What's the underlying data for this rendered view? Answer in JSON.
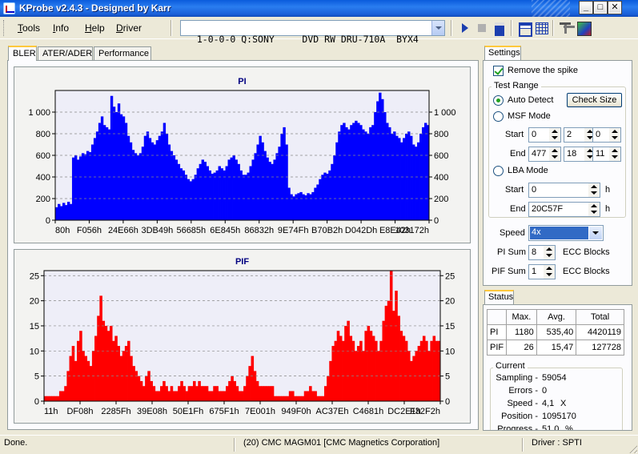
{
  "window": {
    "title": "KProbe v2.4.3 - Designed by Karr",
    "minimize": "_",
    "maximize": "□",
    "close": "✕"
  },
  "menu": {
    "items": [
      {
        "label": "Tools",
        "accel": "T"
      },
      {
        "label": "Info",
        "accel": "I"
      },
      {
        "label": "Help",
        "accel": "H"
      },
      {
        "label": "Driver",
        "accel": "D"
      }
    ]
  },
  "toolbar": {
    "drive": "1-0-0-0 Q:SONY     DVD RW DRU-710A  BYX4"
  },
  "tabs": [
    "BLER",
    "ATER/ADER",
    "Performance"
  ],
  "settings": {
    "tab": "Settings",
    "remove_spike": "Remove the spike",
    "test_range": "Test Range",
    "auto_detect": "Auto Detect",
    "check_size": "Check Size",
    "msf_mode": "MSF Mode",
    "start_label": "Start",
    "end_label": "End",
    "msf_start": [
      "0",
      "2",
      "0"
    ],
    "msf_end": [
      "477",
      "18",
      "11"
    ],
    "lba_mode": "LBA Mode",
    "lba_start": "0",
    "lba_end": "20C57F",
    "h_unit": "h",
    "speed_label": "Speed",
    "speed_value": "4x",
    "pi_sum_label": "PI Sum",
    "pi_sum_value": "8",
    "pif_sum_label": "PIF Sum",
    "pif_sum_value": "1",
    "ecc_blocks": "ECC Blocks"
  },
  "status": {
    "tab": "Status",
    "headers": [
      "",
      "Max.",
      "Avg.",
      "Total"
    ],
    "rows": [
      [
        "PI",
        "1180",
        "535,40",
        "4420119"
      ],
      [
        "PIF",
        "26",
        "15,47",
        "127728"
      ]
    ],
    "current": "Current",
    "sampling_label": "Sampling -",
    "sampling_value": "59054",
    "errors_label": "Errors -",
    "errors_value": "0",
    "speed_label": "Speed -",
    "speed_value": "4,1",
    "speed_unit": "X",
    "position_label": "Position -",
    "position_value": "1095170",
    "progress_label": "Progress -",
    "progress_value": "51,0",
    "progress_unit": "%"
  },
  "statusbar": {
    "left": "Done.",
    "media": "(20) CMC MAGM01 [CMC Magnetics Corporation]",
    "driver": "Driver : SPTI"
  },
  "colors": {
    "pi": "#0000ff",
    "pif": "#ff0000",
    "plot_bg": "#eeeef8"
  },
  "chart_data": [
    {
      "type": "area",
      "title": "PI",
      "ylim": [
        0,
        1200
      ],
      "y_ticks": [
        0,
        200,
        400,
        600,
        800,
        1000
      ],
      "y_tick_labels": [
        "0",
        "200",
        "400",
        "600",
        "800",
        "1 000"
      ],
      "x_tick_labels": [
        "80h",
        "F056h",
        "24E66h",
        "3DB49h",
        "56685h",
        "6E845h",
        "86832h",
        "9E74Fh",
        "B70B2h",
        "D042Dh",
        "E8E42h",
        "103172h"
      ],
      "x_range": [
        0,
        1095170
      ],
      "grid": true,
      "values": [
        120,
        150,
        130,
        160,
        140,
        170,
        150,
        580,
        600,
        560,
        590,
        620,
        610,
        640,
        630,
        700,
        760,
        820,
        900,
        960,
        880,
        860,
        840,
        1150,
        1050,
        1000,
        1080,
        980,
        960,
        900,
        780,
        720,
        650,
        620,
        600,
        620,
        680,
        780,
        820,
        760,
        720,
        700,
        740,
        780,
        820,
        900,
        800,
        700,
        640,
        600,
        560,
        520,
        480,
        460,
        420,
        380,
        360,
        380,
        420,
        480,
        520,
        560,
        540,
        500,
        460,
        430,
        440,
        460,
        500,
        480,
        460,
        500,
        560,
        580,
        600,
        560,
        520,
        460,
        420,
        420,
        440,
        500,
        560,
        620,
        700,
        780,
        720,
        640,
        580,
        540,
        520,
        560,
        620,
        680,
        800,
        860,
        700,
        300,
        240,
        220,
        240,
        250,
        260,
        240,
        230,
        250,
        240,
        260,
        300,
        330,
        380,
        420,
        440,
        430,
        460,
        520,
        600,
        720,
        820,
        880,
        900,
        860,
        840,
        880,
        900,
        920,
        900,
        880,
        840,
        820,
        800,
        860,
        880,
        1000,
        1100,
        1180,
        1120,
        1000,
        900,
        860,
        800,
        820,
        780,
        760,
        720,
        760,
        800,
        820,
        780,
        700,
        680,
        720,
        800,
        860,
        900,
        880
      ]
    },
    {
      "type": "area",
      "title": "PIF",
      "ylim": [
        0,
        26
      ],
      "y_ticks": [
        0,
        5,
        10,
        15,
        20,
        25
      ],
      "y_tick_labels": [
        "0",
        "5",
        "10",
        "15",
        "20",
        "25"
      ],
      "x_tick_labels": [
        "11h",
        "DF08h",
        "2285Fh",
        "39E08h",
        "50E1Fh",
        "675F1h",
        "7E001h",
        "949F0h",
        "AC37Eh",
        "C4681h",
        "DC2E1h",
        "F32F2h"
      ],
      "x_range": [
        0,
        1095170
      ],
      "grid": true,
      "values": [
        1,
        1,
        1,
        1,
        1,
        1,
        2,
        2,
        3,
        6,
        9,
        11,
        8,
        12,
        14,
        10,
        9,
        8,
        7,
        10,
        13,
        17,
        21,
        16,
        15,
        14,
        15,
        12,
        13,
        11,
        9,
        10,
        11,
        12,
        9,
        7,
        6,
        5,
        4,
        3,
        5,
        6,
        4,
        3,
        2,
        2,
        3,
        4,
        3,
        2,
        3,
        2,
        2,
        3,
        4,
        3,
        2,
        3,
        3,
        4,
        3,
        4,
        3,
        3,
        3,
        2,
        2,
        3,
        3,
        2,
        2,
        2,
        3,
        4,
        5,
        4,
        3,
        2,
        2,
        3,
        5,
        7,
        9,
        6,
        4,
        3,
        3,
        3,
        3,
        3,
        3,
        1,
        1,
        1,
        1,
        1,
        1,
        2,
        2,
        1,
        1,
        1,
        1,
        2,
        2,
        3,
        2,
        2,
        1,
        1,
        1,
        3,
        5,
        8,
        11,
        12,
        14,
        13,
        12,
        15,
        16,
        13,
        12,
        10,
        11,
        12,
        10,
        14,
        15,
        14,
        13,
        12,
        10,
        12,
        16,
        19,
        20,
        26,
        18,
        22,
        17,
        14,
        13,
        12,
        10,
        8,
        9,
        10,
        11,
        12,
        13,
        12,
        10,
        12,
        13,
        12,
        12
      ]
    }
  ]
}
